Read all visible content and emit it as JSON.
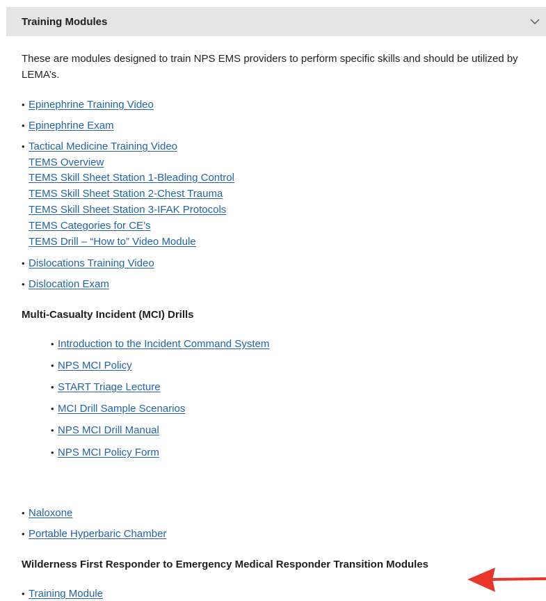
{
  "accordion": {
    "title": "Training Modules",
    "chevron_icon": "chevron-down-icon"
  },
  "intro_text": "These are modules designed to train NPS EMS providers to perform specific skills and should be utilized by LEMA’s.",
  "list1": {
    "epinephrine_video": "Epinephrine Training Video",
    "epinephrine_exam": "Epinephrine Exam",
    "tactical_medicine_video": "Tactical Medicine Training Video",
    "tems_links": [
      "TEMS Overview",
      "TEMS Skill Sheet Station 1-Bleading Control",
      "TEMS Skill Sheet Station 2-Chest Trauma",
      "TEMS Skill Sheet Station 3-IFAK Protocols",
      "TEMS Categories for CE’s",
      "TEMS Drill – “How to” Video Module"
    ],
    "dislocations_video": "Dislocations Training Video",
    "dislocation_exam": "Dislocation Exam"
  },
  "mci": {
    "heading": "Multi-Casualty Incident (MCI) Drills",
    "items": [
      "Introduction to the Incident Command System",
      "NPS MCI Policy",
      "START Triage Lecture",
      "MCI Drill Sample Scenarios",
      "NPS MCI Drill Manual",
      "NPS MCI Policy Form"
    ]
  },
  "list2": {
    "naloxone": "Naloxone",
    "hyperbaric": "Portable Hyperbaric Chamber"
  },
  "wfr": {
    "heading": "Wilderness First Responder to Emergency Medical Responder Transition Modules",
    "training_module": "Training Module"
  },
  "colors": {
    "link": "#2264a8",
    "header_bg": "#e5e5e5",
    "arrow": "#e8352a"
  }
}
